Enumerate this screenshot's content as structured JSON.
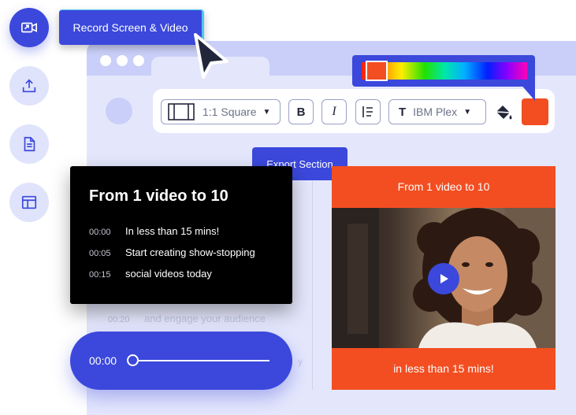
{
  "rail": {
    "items": [
      {
        "icon": "record-video-icon",
        "active": true
      },
      {
        "icon": "upload-icon",
        "active": false
      },
      {
        "icon": "document-icon",
        "active": false
      },
      {
        "icon": "layout-icon",
        "active": false
      }
    ]
  },
  "tooltips": {
    "record": "Record Screen & Video",
    "export": "Export Section"
  },
  "toolbar": {
    "aspect_label": "1:1 Square",
    "bold_label": "B",
    "italic_label": "I",
    "font_prefix": "T",
    "font_label": "IBM Plex",
    "fill_icon": "paint-bucket-icon",
    "selected_color": "#f24e22"
  },
  "transcript": {
    "title": "From 1 video to 10",
    "rows": [
      {
        "time": "00:00",
        "text": "In less than 15 mins!"
      },
      {
        "time": "00:05",
        "text": "Start creating show-stopping"
      },
      {
        "time": "00:15",
        "text": "social videos today"
      }
    ],
    "faded_row": {
      "time": "00:20",
      "text": "and engage your audience"
    },
    "faded_tail": "y"
  },
  "player": {
    "time": "00:00",
    "progress": 0
  },
  "preview": {
    "title": "From 1 video to 10",
    "caption": "in less than 15 mins!"
  },
  "colors": {
    "accent": "#3b48db",
    "orange": "#f24e22",
    "window": "#c9cff8"
  }
}
